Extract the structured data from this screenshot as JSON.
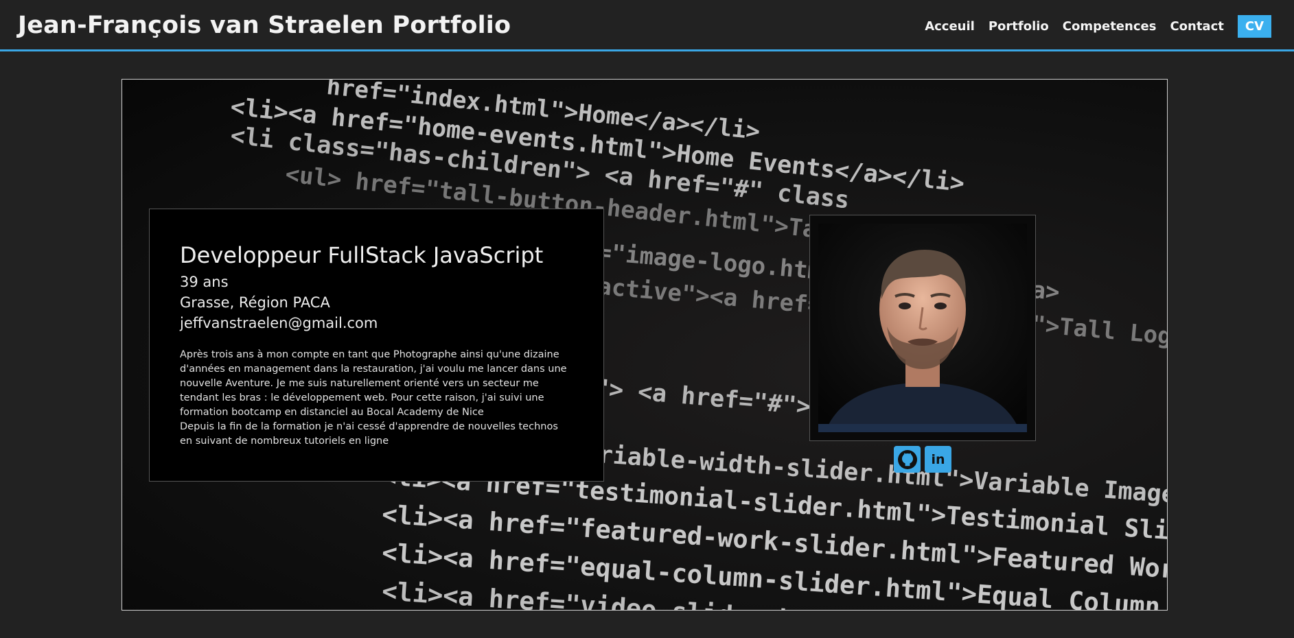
{
  "header": {
    "site_title": "Jean-François van Straelen Portfolio",
    "nav": [
      "Acceuil",
      "Portfolio",
      "Competences",
      "Contact"
    ],
    "cv_label": "CV",
    "accent_color": "#3aa7e6"
  },
  "hero": {
    "background_code": [
      "href=\"index.html\">Home</a></li>",
      "<li><a href=\"home-events.html\">Home Events</a></li>",
      "<li class=\"has-children\"> <a href=\"#\" class",
      "<ul>  href=\"tall-button-header.html\">Tall Button",
      "<li><a href=\"image-logo.html\">Image Logo</a>",
      "<li class=\"active\"><a href=\"tall-logo.html\">Tall Logo Image</a>",
      "\"> <a href=\"#\">Carousels</a>",
      "<li><a href=\"variable-width-slider.html\">Variable Image Width",
      "<li><a href=\"testimonial-slider.html\">Testimonial Slider</a>",
      "<li><a href=\"featured-work-slider.html\">Featured Work Slider</a>",
      "<li><a href=\"equal-column-slider.html\">Equal Column Slider</a>",
      "<li><a href=\"video-slider.html\">Video Slider</a></li>"
    ],
    "info": {
      "title": "Developpeur FullStack JavaScript",
      "age": "39 ans",
      "location": "Grasse, Région PACA",
      "email": "jeffvanstraelen@gmail.com",
      "bio_1": "Après trois ans à mon compte en tant que Photographe ainsi qu'une dizaine d'années en management dans la restauration, j'ai voulu me lancer dans une nouvelle Aventure. Je me suis naturellement orienté vers un secteur me tendant les bras : le développement web. Pour cette raison, j'ai suivi une formation bootcamp en distanciel au Bocal Academy de Nice",
      "bio_2": "Depuis la fin de la formation je n'ai cessé d'apprendre de nouvelles technos en suivant de nombreux tutoriels en ligne"
    },
    "socials": [
      {
        "icon": "github-icon"
      },
      {
        "icon": "linkedin-icon",
        "label": "in"
      }
    ]
  }
}
